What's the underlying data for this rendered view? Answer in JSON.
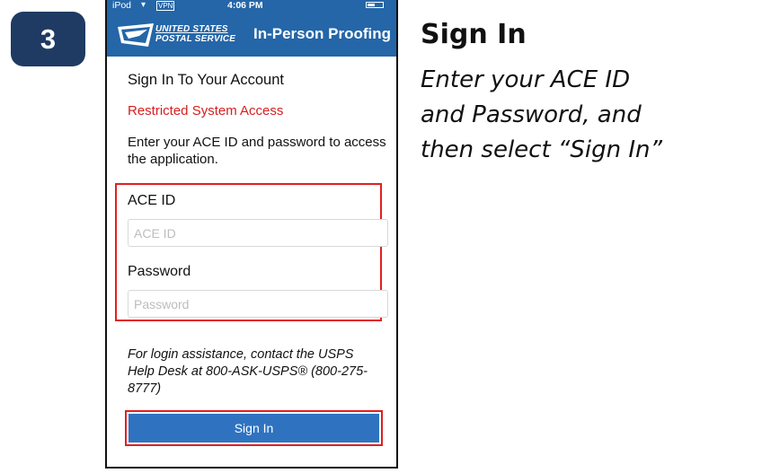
{
  "step": {
    "number": "3"
  },
  "status_bar": {
    "device": "iPod",
    "vpn": "VPN",
    "time": "4:06 PM"
  },
  "nav": {
    "logo_line1": "UNITED STATES",
    "logo_line2": "POSTAL SERVICE",
    "title": "In-Person Proofing"
  },
  "form": {
    "heading": "Sign In To Your Account",
    "restricted": "Restricted System Access",
    "instructions": "Enter your ACE ID and password to access the application.",
    "ace_id_label": "ACE ID",
    "ace_id_placeholder": "ACE ID",
    "ace_id_value": "",
    "password_label": "Password",
    "password_placeholder": "Password",
    "password_value": "",
    "help_text": "For login assistance, contact the USPS Help Desk at 800-ASK-USPS® (800-275-8777)",
    "signin_label": "Sign In"
  },
  "side": {
    "title": "Sign In",
    "desc_line1": "Enter your ACE ID",
    "desc_line2": "and Password, and",
    "desc_line3": "then select “Sign In”"
  },
  "colors": {
    "badge": "#1f3b63",
    "usps_blue": "#2466a8",
    "button_blue": "#2f73c0",
    "highlight_red": "#e02020",
    "restricted_red": "#d42020"
  },
  "icons": [
    "wifi-icon",
    "battery-icon",
    "usps-eagle-logo-icon"
  ]
}
